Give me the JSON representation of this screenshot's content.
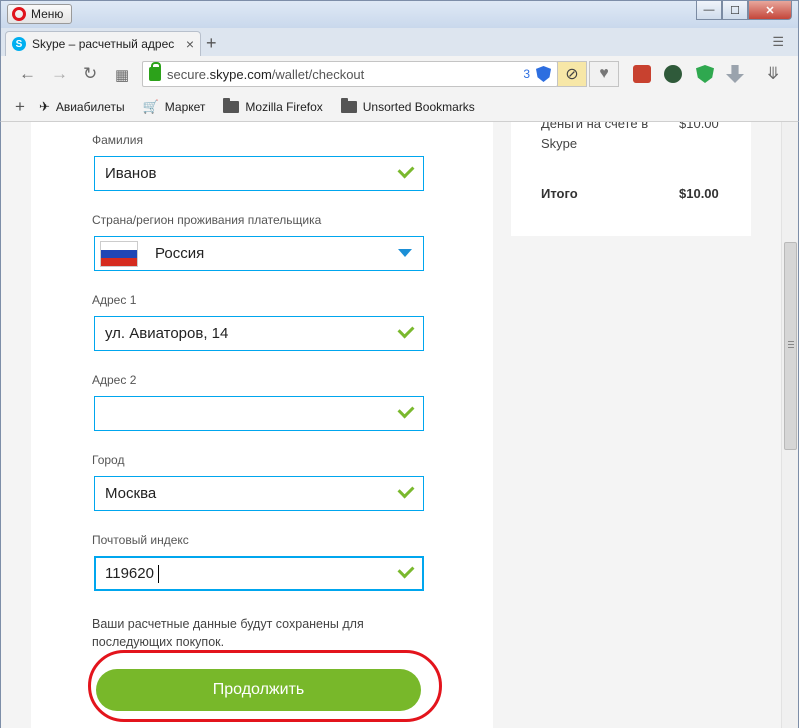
{
  "window": {
    "menu_label": "Меню",
    "minimize": "—",
    "maximize": "☐",
    "close": "✕"
  },
  "tab": {
    "title": "Skype – расчетный адрес",
    "close": "×",
    "new_tab": "+",
    "tab_menu": "☰"
  },
  "address_bar": {
    "url_prefix": "secure.",
    "url_host": "skype.com",
    "url_path": "/wallet/checkout",
    "tracker_count": "3"
  },
  "bookmarks": {
    "add": "+",
    "items": [
      {
        "label": "Авиабилеты",
        "icon": "plane-icon"
      },
      {
        "label": "Маркет",
        "icon": "cart-icon"
      },
      {
        "label": "Mozilla Firefox",
        "icon": "folder-icon"
      },
      {
        "label": "Unsorted Bookmarks",
        "icon": "folder-icon"
      }
    ]
  },
  "form": {
    "surname": {
      "label": "Фамилия",
      "value": "Иванов"
    },
    "country": {
      "label": "Страна/регион проживания плательщика",
      "value": "Россия"
    },
    "address1": {
      "label": "Адрес 1",
      "value": "ул. Авиаторов, 14"
    },
    "address2": {
      "label": "Адрес 2",
      "value": ""
    },
    "city": {
      "label": "Город",
      "value": "Москва"
    },
    "postcode": {
      "label": "Почтовый индекс",
      "value": "119620"
    },
    "note": "Ваши расчетные данные будут сохранены для последующих покупок.",
    "continue_label": "Продолжить"
  },
  "summary": {
    "balance_label": "Деньги на счете в Skype",
    "balance_amount": "$10.00",
    "total_label": "Итого",
    "total_amount": "$10.00"
  },
  "colors": {
    "accent_blue": "#00a6ee",
    "button_green": "#78b82a",
    "highlight_red": "#e3141c",
    "check_green": "#7ab92e"
  }
}
